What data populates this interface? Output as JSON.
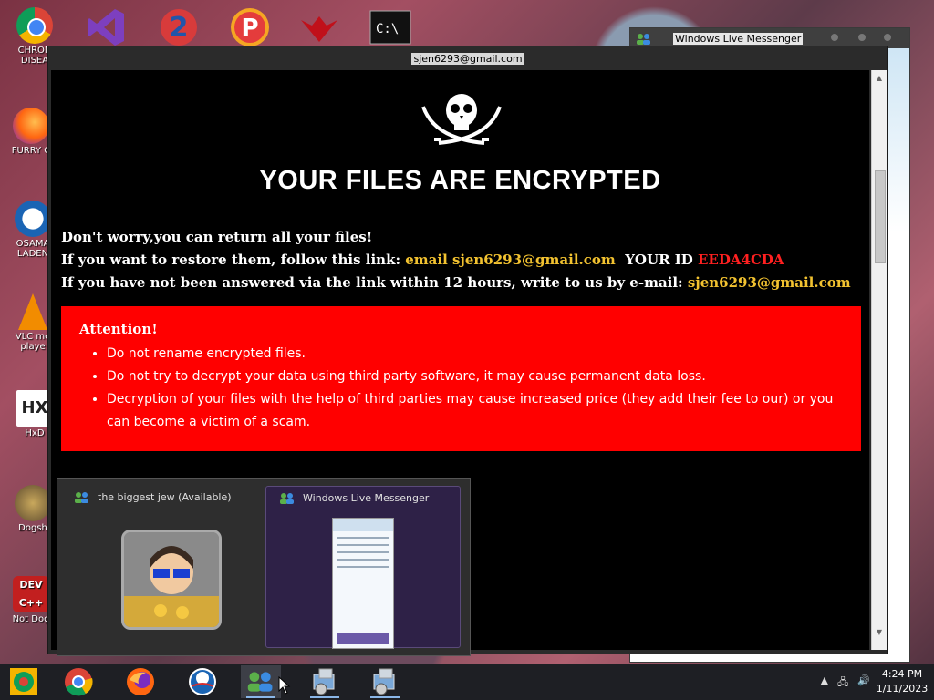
{
  "desktop_icons": [
    {
      "name": "chrome-desktop-icon",
      "label": "CHRON\nDISEA"
    },
    {
      "name": "firefox-desktop-icon",
      "label": "FURRY C"
    },
    {
      "name": "obama-desktop-icon",
      "label": "OSAMA\nLADEN"
    },
    {
      "name": "vlc-desktop-icon",
      "label": "VLC me\nplaye"
    },
    {
      "name": "hxd-desktop-icon",
      "label": "HxD"
    },
    {
      "name": "dogs-desktop-icon",
      "label": "Dogsh"
    },
    {
      "name": "devcpp-desktop-icon",
      "label": "Not Dog"
    }
  ],
  "messenger_window": {
    "title": "Windows Live Messenger"
  },
  "ransom_window": {
    "title": "sjen6293@gmail.com",
    "headline": "YOUR FILES ARE ENCRYPTED",
    "line1": "Don't worry,you can return all your files!",
    "line2_prefix": "If you want to restore them, follow this link: ",
    "line2_link": "email sjen6293@gmail.com",
    "line2_id_label": "  YOUR ID ",
    "line2_id": "EEDA4CDA",
    "line3_prefix": "If you have not been answered via the link within 12 hours, write to us by e-mail: ",
    "line3_email": "sjen6293@gmail.com",
    "attention_title": "Attention!",
    "attention_items": [
      "Do not rename encrypted files.",
      "Do not try to decrypt your data using third party software, it may cause permanent data loss.",
      "Decryption of your files with the help of third parties may cause increased price (they add their fee to our) or you can become a victim of a scam."
    ]
  },
  "thumbnails": [
    {
      "label": "the biggest jew (Available)"
    },
    {
      "label": "Windows Live Messenger"
    }
  ],
  "clock": {
    "time": "4:24 PM",
    "date": "1/11/2023"
  },
  "colors": {
    "warning_red": "#ff0000",
    "link_yellow": "#f2c230",
    "id_red": "#ff2020"
  }
}
